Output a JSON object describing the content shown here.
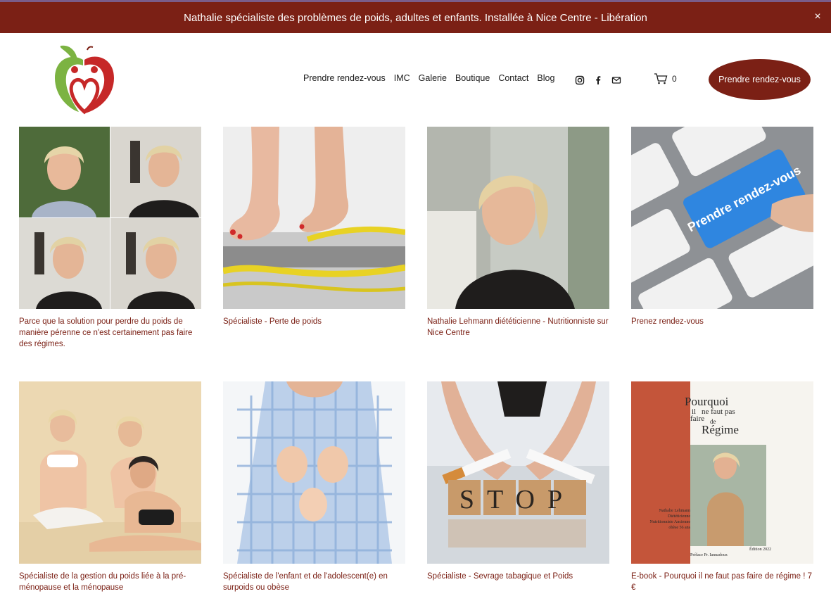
{
  "banner": {
    "text": "Nathalie spécialiste des problèmes de poids, adultes et enfants. Installée à Nice Centre - Libération",
    "close_glyph": "×"
  },
  "header": {
    "logo_icon": "apple-heart-logo",
    "nav": [
      "Prendre rendez-vous",
      "IMC",
      "Galerie",
      "Boutique",
      "Contact",
      "Blog"
    ],
    "social_icons": [
      "instagram-icon",
      "facebook-icon",
      "email-icon"
    ],
    "cart_count": "0",
    "cta_label": "Prendre rendez-vous"
  },
  "colors": {
    "brand": "#7b2015",
    "banner_bg": "#7b2015",
    "caption": "#7b2015"
  },
  "cards": [
    {
      "caption": "Parce que la solution pour perdre du poids de manière pérenne ce n'est certainement pas faire des régimes."
    },
    {
      "caption": "Spécialiste - Perte de poids"
    },
    {
      "caption": "Nathalie Lehmann diététicienne - Nutritionniste sur Nice Centre"
    },
    {
      "caption": "Prenez rendez-vous",
      "key_text": "Prendre rendez-vous"
    },
    {
      "caption": "Spécialiste de la gestion du poids liée à la pré-ménopause et la ménopause"
    },
    {
      "caption": "Spécialiste de l'enfant et de l'adolescent(e) en surpoids ou obèse"
    },
    {
      "caption": "Spécialiste - Sevrage tabagique et Poids",
      "cube_text": "STOP"
    },
    {
      "caption": "E-book - Pourquoi il ne faut pas faire de régime ! 7 €",
      "book": {
        "title_line1": "Pourquoi",
        "title_line2": "il",
        "title_line3": "ne faut pas",
        "title_line4": "faire",
        "title_line5": "de",
        "title_line6": "Régime",
        "author": "Nathalie Lehmann Diététicienne Nutritionniste Ancienne obèse 56 ans",
        "preface": "Préface Pr. Iannadoux",
        "edition": "Édition 2022"
      }
    }
  ]
}
